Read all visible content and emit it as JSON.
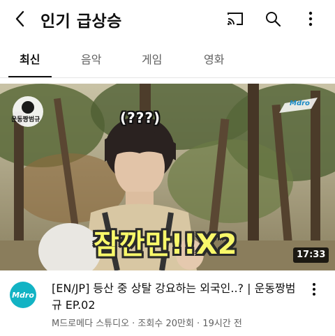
{
  "header": {
    "title": "인기 급상승",
    "back_icon": "chevron-left-icon",
    "cast_icon": "cast-icon",
    "search_icon": "search-icon",
    "more_icon": "more-vertical-icon"
  },
  "tabs": [
    {
      "label": "최신",
      "active": true
    },
    {
      "label": "음악",
      "active": false
    },
    {
      "label": "게임",
      "active": false
    },
    {
      "label": "영화",
      "active": false
    }
  ],
  "video": {
    "caption_top": "(???)",
    "caption_main": "잠깐만!!X2",
    "watermark_left": "운동짱범규",
    "watermark_right": "Mdro",
    "duration": "17:33",
    "channel_avatar_text": "Mdro",
    "title": "[EN/JP] 등산 중 상탈 강요하는 외국인..? | 운동짱범규 EP.02",
    "meta": "M드로메다 스튜디오 · 조회수 20만회 · 19시간 전",
    "menu_icon": "more-vertical-icon"
  }
}
